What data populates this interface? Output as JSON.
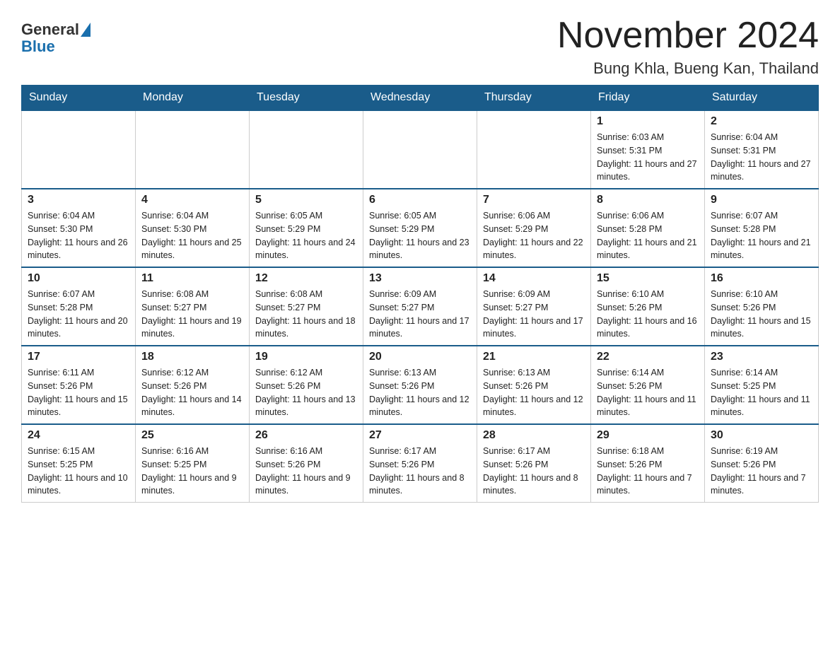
{
  "header": {
    "logo": {
      "general": "General",
      "blue": "Blue"
    },
    "title": "November 2024",
    "location": "Bung Khla, Bueng Kan, Thailand"
  },
  "calendar": {
    "days_of_week": [
      "Sunday",
      "Monday",
      "Tuesday",
      "Wednesday",
      "Thursday",
      "Friday",
      "Saturday"
    ],
    "weeks": [
      [
        {
          "day": "",
          "info": ""
        },
        {
          "day": "",
          "info": ""
        },
        {
          "day": "",
          "info": ""
        },
        {
          "day": "",
          "info": ""
        },
        {
          "day": "",
          "info": ""
        },
        {
          "day": "1",
          "info": "Sunrise: 6:03 AM\nSunset: 5:31 PM\nDaylight: 11 hours and 27 minutes."
        },
        {
          "day": "2",
          "info": "Sunrise: 6:04 AM\nSunset: 5:31 PM\nDaylight: 11 hours and 27 minutes."
        }
      ],
      [
        {
          "day": "3",
          "info": "Sunrise: 6:04 AM\nSunset: 5:30 PM\nDaylight: 11 hours and 26 minutes."
        },
        {
          "day": "4",
          "info": "Sunrise: 6:04 AM\nSunset: 5:30 PM\nDaylight: 11 hours and 25 minutes."
        },
        {
          "day": "5",
          "info": "Sunrise: 6:05 AM\nSunset: 5:29 PM\nDaylight: 11 hours and 24 minutes."
        },
        {
          "day": "6",
          "info": "Sunrise: 6:05 AM\nSunset: 5:29 PM\nDaylight: 11 hours and 23 minutes."
        },
        {
          "day": "7",
          "info": "Sunrise: 6:06 AM\nSunset: 5:29 PM\nDaylight: 11 hours and 22 minutes."
        },
        {
          "day": "8",
          "info": "Sunrise: 6:06 AM\nSunset: 5:28 PM\nDaylight: 11 hours and 21 minutes."
        },
        {
          "day": "9",
          "info": "Sunrise: 6:07 AM\nSunset: 5:28 PM\nDaylight: 11 hours and 21 minutes."
        }
      ],
      [
        {
          "day": "10",
          "info": "Sunrise: 6:07 AM\nSunset: 5:28 PM\nDaylight: 11 hours and 20 minutes."
        },
        {
          "day": "11",
          "info": "Sunrise: 6:08 AM\nSunset: 5:27 PM\nDaylight: 11 hours and 19 minutes."
        },
        {
          "day": "12",
          "info": "Sunrise: 6:08 AM\nSunset: 5:27 PM\nDaylight: 11 hours and 18 minutes."
        },
        {
          "day": "13",
          "info": "Sunrise: 6:09 AM\nSunset: 5:27 PM\nDaylight: 11 hours and 17 minutes."
        },
        {
          "day": "14",
          "info": "Sunrise: 6:09 AM\nSunset: 5:27 PM\nDaylight: 11 hours and 17 minutes."
        },
        {
          "day": "15",
          "info": "Sunrise: 6:10 AM\nSunset: 5:26 PM\nDaylight: 11 hours and 16 minutes."
        },
        {
          "day": "16",
          "info": "Sunrise: 6:10 AM\nSunset: 5:26 PM\nDaylight: 11 hours and 15 minutes."
        }
      ],
      [
        {
          "day": "17",
          "info": "Sunrise: 6:11 AM\nSunset: 5:26 PM\nDaylight: 11 hours and 15 minutes."
        },
        {
          "day": "18",
          "info": "Sunrise: 6:12 AM\nSunset: 5:26 PM\nDaylight: 11 hours and 14 minutes."
        },
        {
          "day": "19",
          "info": "Sunrise: 6:12 AM\nSunset: 5:26 PM\nDaylight: 11 hours and 13 minutes."
        },
        {
          "day": "20",
          "info": "Sunrise: 6:13 AM\nSunset: 5:26 PM\nDaylight: 11 hours and 12 minutes."
        },
        {
          "day": "21",
          "info": "Sunrise: 6:13 AM\nSunset: 5:26 PM\nDaylight: 11 hours and 12 minutes."
        },
        {
          "day": "22",
          "info": "Sunrise: 6:14 AM\nSunset: 5:26 PM\nDaylight: 11 hours and 11 minutes."
        },
        {
          "day": "23",
          "info": "Sunrise: 6:14 AM\nSunset: 5:25 PM\nDaylight: 11 hours and 11 minutes."
        }
      ],
      [
        {
          "day": "24",
          "info": "Sunrise: 6:15 AM\nSunset: 5:25 PM\nDaylight: 11 hours and 10 minutes."
        },
        {
          "day": "25",
          "info": "Sunrise: 6:16 AM\nSunset: 5:25 PM\nDaylight: 11 hours and 9 minutes."
        },
        {
          "day": "26",
          "info": "Sunrise: 6:16 AM\nSunset: 5:26 PM\nDaylight: 11 hours and 9 minutes."
        },
        {
          "day": "27",
          "info": "Sunrise: 6:17 AM\nSunset: 5:26 PM\nDaylight: 11 hours and 8 minutes."
        },
        {
          "day": "28",
          "info": "Sunrise: 6:17 AM\nSunset: 5:26 PM\nDaylight: 11 hours and 8 minutes."
        },
        {
          "day": "29",
          "info": "Sunrise: 6:18 AM\nSunset: 5:26 PM\nDaylight: 11 hours and 7 minutes."
        },
        {
          "day": "30",
          "info": "Sunrise: 6:19 AM\nSunset: 5:26 PM\nDaylight: 11 hours and 7 minutes."
        }
      ]
    ]
  }
}
